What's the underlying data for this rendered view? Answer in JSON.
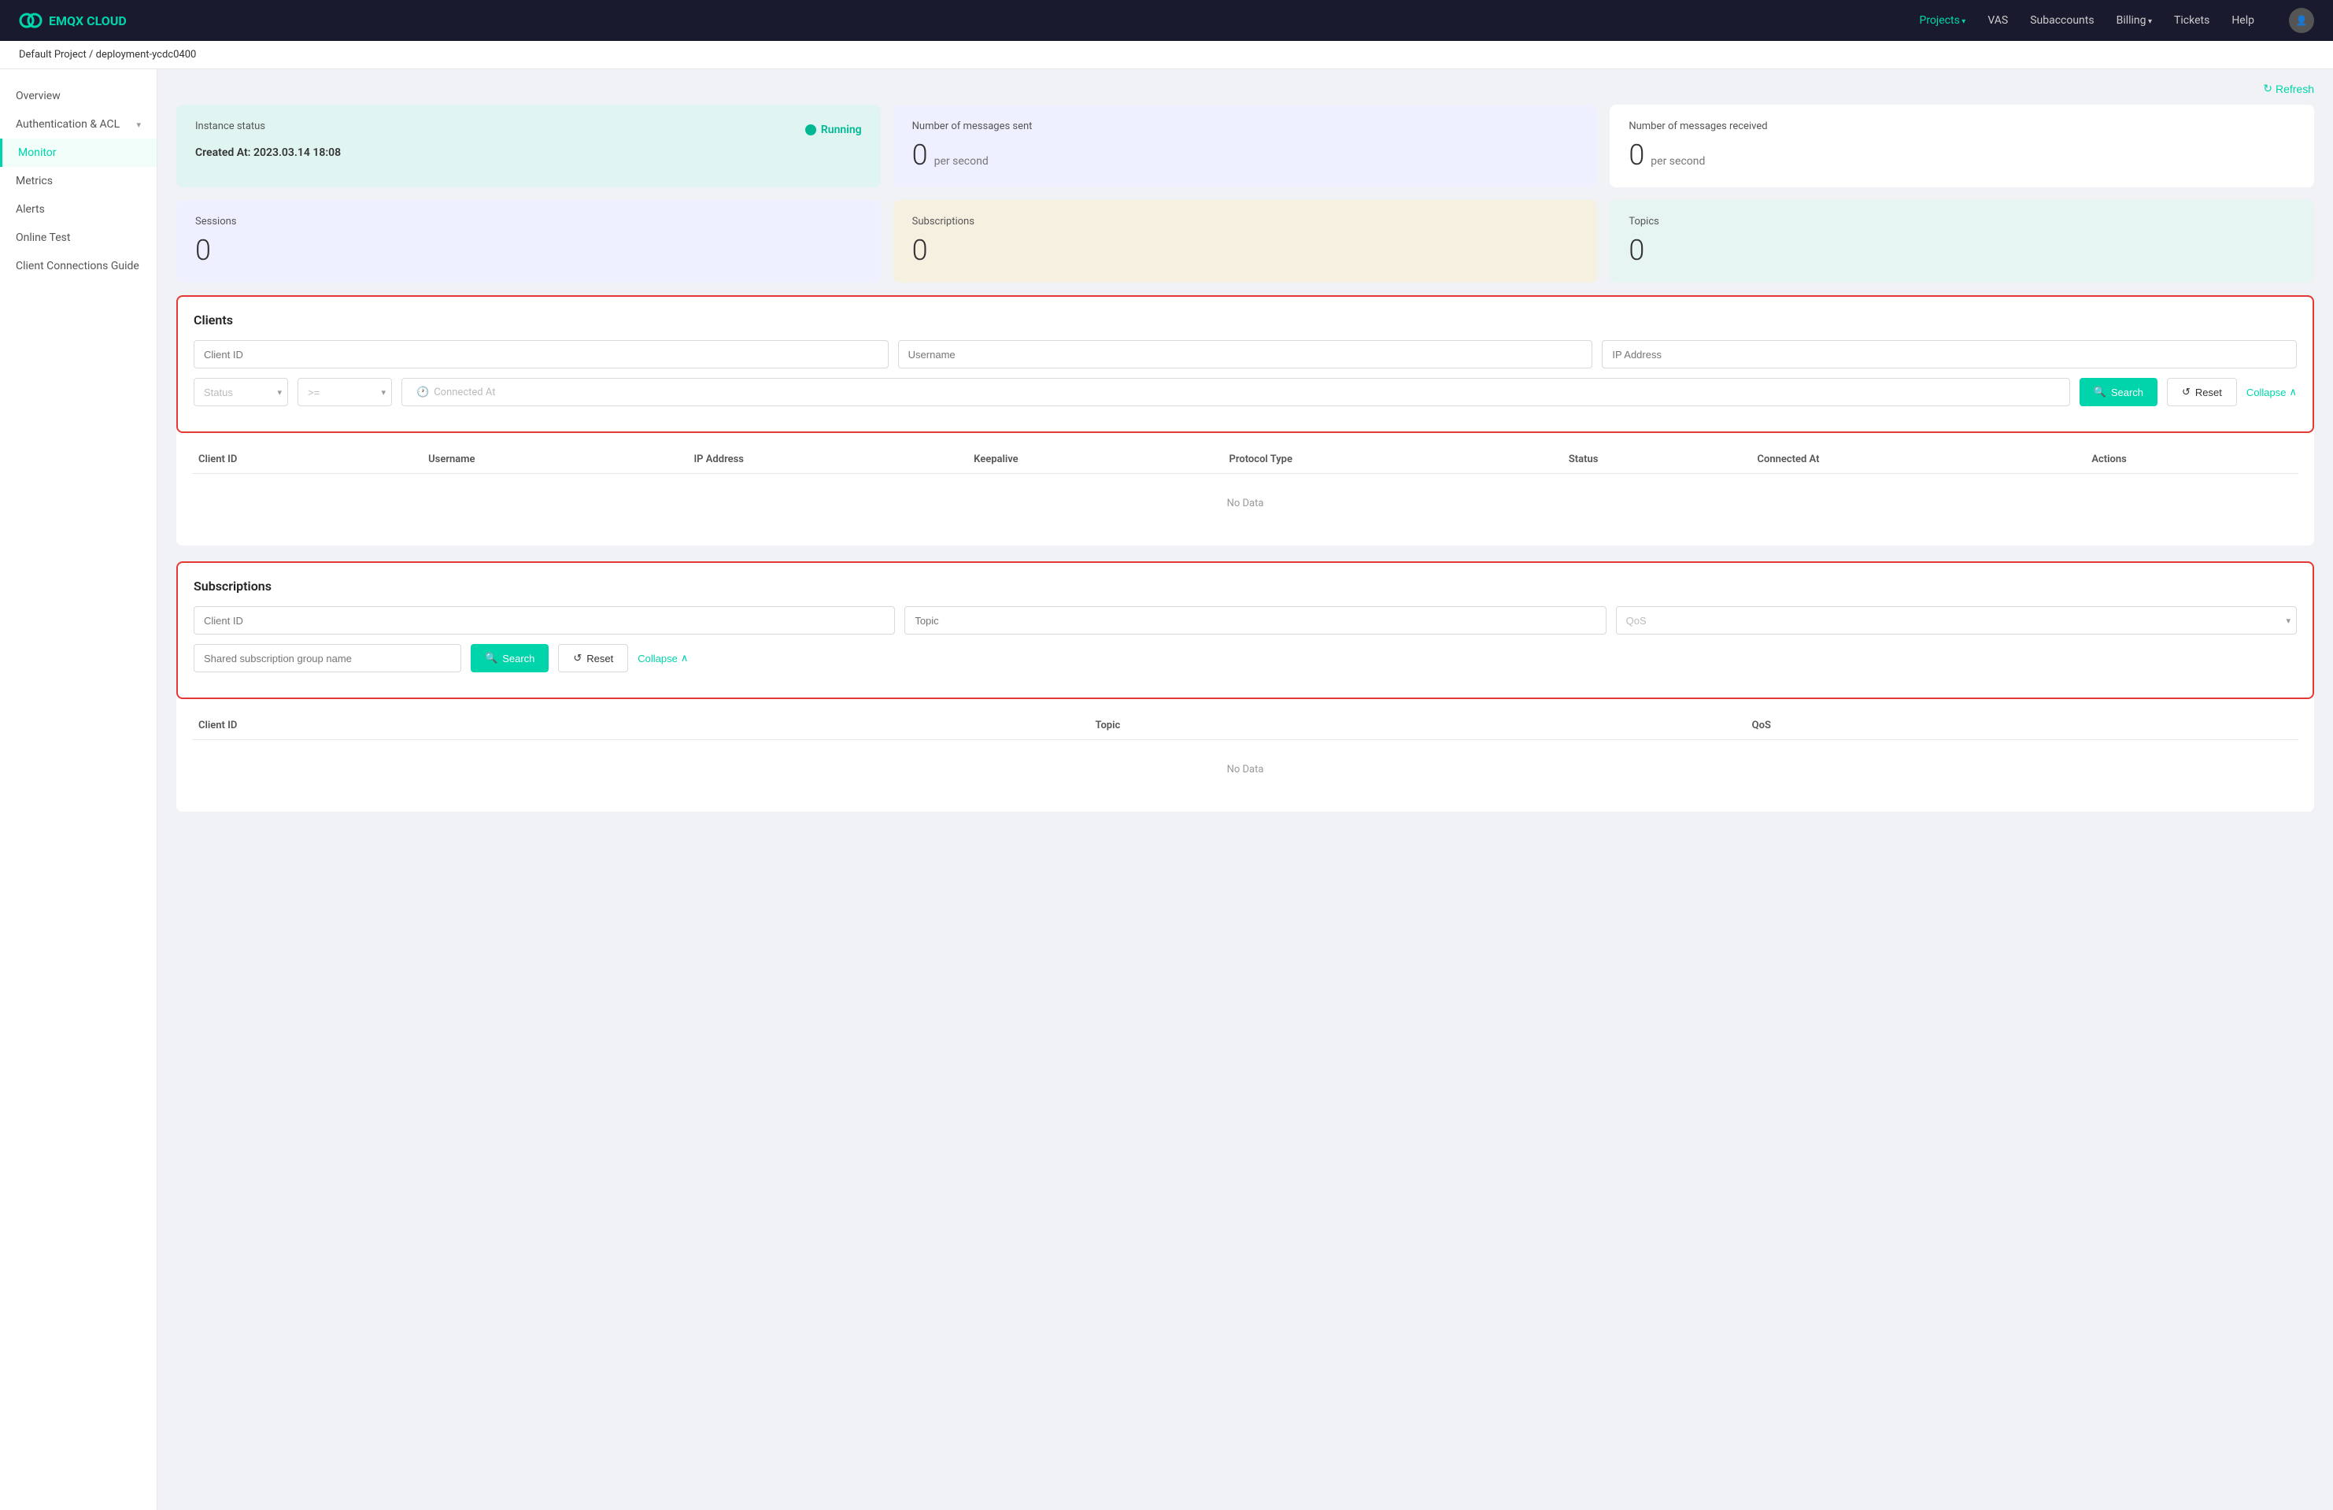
{
  "topnav": {
    "logo_text": "EMQX CLOUD",
    "links": [
      {
        "label": "Projects",
        "active": true,
        "has_arrow": true
      },
      {
        "label": "VAS",
        "active": false
      },
      {
        "label": "Subaccounts",
        "active": false
      },
      {
        "label": "Billing",
        "active": false,
        "has_arrow": true
      },
      {
        "label": "Tickets",
        "active": false
      },
      {
        "label": "Help",
        "active": false
      }
    ]
  },
  "breadcrumb": {
    "project": "Default Project",
    "separator": "/",
    "deployment": "deployment-ycdc0400"
  },
  "sidebar": {
    "items": [
      {
        "label": "Overview",
        "active": false
      },
      {
        "label": "Authentication & ACL",
        "active": false,
        "has_arrow": true
      },
      {
        "label": "Monitor",
        "active": true
      },
      {
        "label": "Metrics",
        "active": false
      },
      {
        "label": "Alerts",
        "active": false
      },
      {
        "label": "Online Test",
        "active": false
      },
      {
        "label": "Client Connections Guide",
        "active": false
      }
    ]
  },
  "main": {
    "refresh_label": "Refresh",
    "stat_cards": [
      {
        "type": "instance",
        "label": "Instance status",
        "status": "Running",
        "created_label": "Created At:",
        "created_value": "2023.03.14 18:08",
        "color": "status-card"
      },
      {
        "type": "messages_sent",
        "label": "Number of messages sent",
        "value": "0",
        "unit": "per second",
        "color": "blue"
      },
      {
        "type": "messages_received",
        "label": "Number of messages received",
        "value": "0",
        "unit": "per second",
        "color": ""
      }
    ],
    "stat_cards_row2": [
      {
        "type": "sessions",
        "label": "Sessions",
        "value": "0",
        "color": "blue"
      },
      {
        "type": "subscriptions",
        "label": "Subscriptions",
        "value": "0",
        "color": "tan"
      },
      {
        "type": "topics",
        "label": "Topics",
        "value": "0",
        "color": "teal"
      }
    ],
    "clients_section": {
      "title": "Clients",
      "filters": {
        "client_id_placeholder": "Client ID",
        "username_placeholder": "Username",
        "ip_address_placeholder": "IP Address",
        "status_placeholder": "Status",
        "ge_operator": ">=",
        "connected_at_placeholder": "Connected At",
        "search_label": "Search",
        "reset_label": "Reset",
        "collapse_label": "Collapse"
      },
      "table_headers": [
        "Client ID",
        "Username",
        "IP Address",
        "Keepalive",
        "Protocol Type",
        "Status",
        "Connected At",
        "Actions"
      ],
      "no_data": "No Data"
    },
    "subscriptions_section": {
      "title": "Subscriptions",
      "filters": {
        "client_id_placeholder": "Client ID",
        "topic_placeholder": "Topic",
        "qos_placeholder": "QoS",
        "shared_group_placeholder": "Shared subscription group name",
        "search_label": "Search",
        "reset_label": "Reset",
        "collapse_label": "Collapse"
      },
      "table_headers": [
        "Client ID",
        "Topic",
        "QoS"
      ],
      "no_data": "No Data"
    }
  }
}
